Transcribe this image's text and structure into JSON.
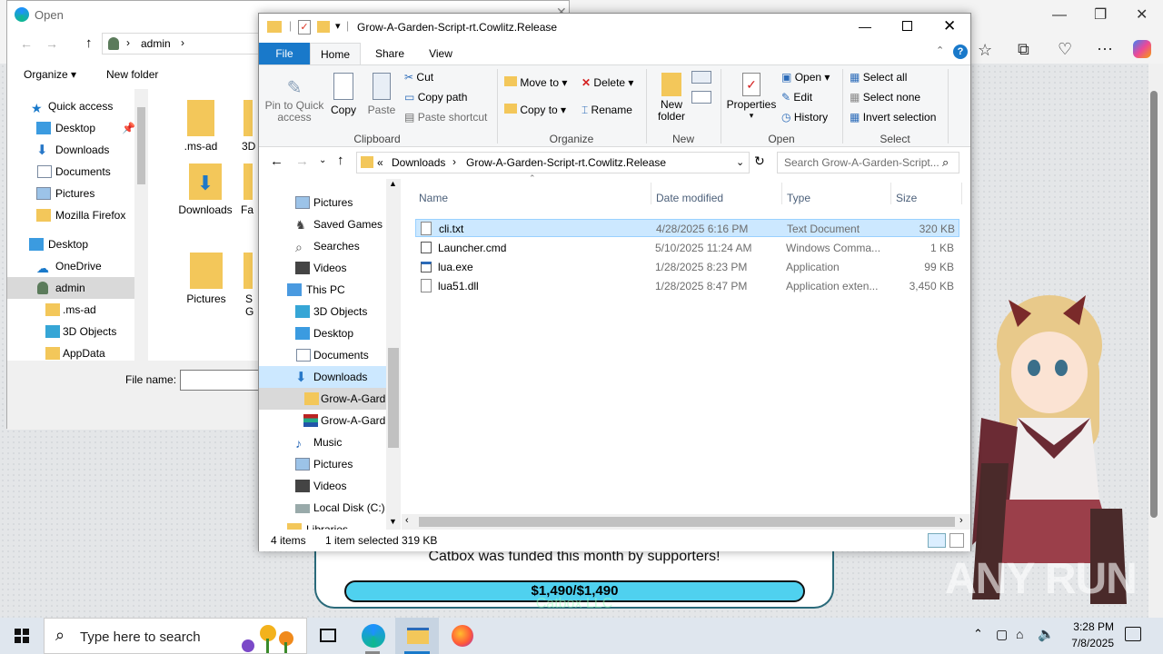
{
  "open_dialog": {
    "title": "Open",
    "path": "admin",
    "organize": "Organize",
    "new_folder": "New folder",
    "tree": [
      "Quick access",
      "Desktop",
      "Downloads",
      "Documents",
      "Pictures",
      "Mozilla Firefox",
      "Desktop",
      "OneDrive",
      "admin",
      ".ms-ad",
      "3D Objects",
      "AppData"
    ],
    "files": [
      ".ms-ad",
      "3D",
      "Downloads",
      "Fa",
      "Pictures",
      "S G"
    ],
    "file_name_label": "File name:"
  },
  "explorer": {
    "title": "Grow-A-Garden-Script-rt.Cowlitz.Release",
    "tabs": [
      "File",
      "Home",
      "Share",
      "View"
    ],
    "ribbon": {
      "pin": "Pin to Quick access",
      "copy": "Copy",
      "paste": "Paste",
      "cut": "Cut",
      "copy_path": "Copy path",
      "paste_shortcut": "Paste shortcut",
      "clipboard": "Clipboard",
      "move_to": "Move to",
      "copy_to": "Copy to",
      "delete": "Delete",
      "rename": "Rename",
      "organize": "Organize",
      "new_folder": "New folder",
      "new": "New",
      "properties": "Properties",
      "open": "Open",
      "edit": "Edit",
      "history": "History",
      "open_group": "Open",
      "select_all": "Select all",
      "select_none": "Select none",
      "invert_selection": "Invert selection",
      "select": "Select"
    },
    "breadcrumb": [
      "«",
      "Downloads",
      "Grow-A-Garden-Script-rt.Cowlitz.Release"
    ],
    "search_placeholder": "Search Grow-A-Garden-Script...",
    "nav": [
      "Pictures",
      "Saved Games",
      "Searches",
      "Videos",
      "This PC",
      "3D Objects",
      "Desktop",
      "Documents",
      "Downloads",
      "Grow-A-Gard",
      "Grow-A-Gard",
      "Music",
      "Pictures",
      "Videos",
      "Local Disk (C:)",
      "Libraries"
    ],
    "columns": [
      "Name",
      "Date modified",
      "Type",
      "Size"
    ],
    "files": [
      {
        "name": "cli.txt",
        "date": "4/28/2025 6:16 PM",
        "type": "Text Document",
        "size": "320 KB"
      },
      {
        "name": "Launcher.cmd",
        "date": "5/10/2025 11:24 AM",
        "type": "Windows Comma...",
        "size": "1 KB"
      },
      {
        "name": "lua.exe",
        "date": "1/28/2025 8:23 PM",
        "type": "Application",
        "size": "99 KB"
      },
      {
        "name": "lua51.dll",
        "date": "1/28/2025 8:47 PM",
        "type": "Application exten...",
        "size": "3,450 KB"
      }
    ],
    "status": {
      "items": "4 items",
      "selected": "1 item selected",
      "size": "319 KB"
    }
  },
  "background_page": {
    "funded_text": "Catbox was funded this month by supporters!",
    "funding": "$1,490/$1,490",
    "llc": "Catbox LLC",
    "watermark": "ANY RUN"
  },
  "taskbar": {
    "search_placeholder": "Type here to search",
    "time": "3:28 PM",
    "date": "7/8/2025"
  },
  "colors": {
    "accent": "#1979ca",
    "selection": "#cce8ff",
    "taskbar": "#dfe6ee"
  }
}
